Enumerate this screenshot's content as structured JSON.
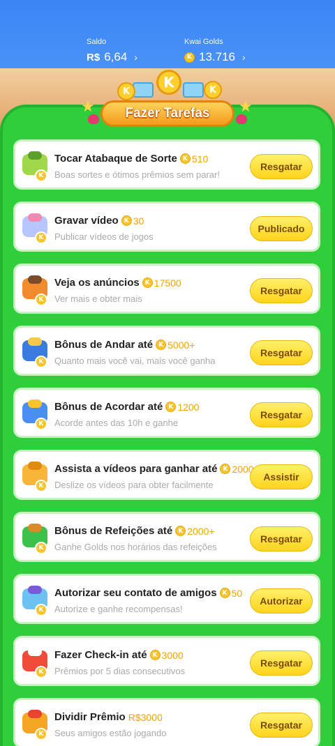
{
  "header": {
    "saldo_label": "Saldo",
    "saldo_currency": "R$",
    "saldo_value": "6,64",
    "golds_label": "Kwai Golds",
    "golds_value": "13.716",
    "chevron": "›"
  },
  "banner": {
    "title": "Fazer Tarefas",
    "coin_letter": "K"
  },
  "tasks": [
    {
      "title": "Tocar Atabaque de Sorte",
      "reward": "510",
      "subtitle": "Boas sortes e ótimos prêmios sem parar!",
      "button": "Resgatar",
      "icon": "drum-icon"
    },
    {
      "title": "Gravar vídeo",
      "reward": "30",
      "subtitle": "Publicar vídeos de jogos",
      "button": "Publicado",
      "icon": "video-camera-icon"
    },
    {
      "title": "Veja os anúncios",
      "reward": "17500",
      "subtitle": "Ver mais e obter mais",
      "button": "Resgatar",
      "icon": "tv-icon"
    },
    {
      "title": "Bônus de Andar até",
      "reward": "5000+",
      "subtitle": "Quanto mais você vai, mais você ganha",
      "button": "Resgatar",
      "icon": "walking-boy-icon"
    },
    {
      "title": "Bônus de Acordar até",
      "reward": "1200",
      "subtitle": "Acorde antes das 10h e ganhe",
      "button": "Resgatar",
      "icon": "moon-icon"
    },
    {
      "title": "Assista a vídeos para ganhar até",
      "reward": "2000",
      "subtitle": "Deslize os vídeos para obter facilmente",
      "button": "Assistir",
      "icon": "camera-icon"
    },
    {
      "title": "Bônus de Refeições até",
      "reward": "2000+",
      "subtitle": "Ganhe Golds nos horários das refeições",
      "button": "Resgatar",
      "icon": "meal-calendar-icon"
    },
    {
      "title": "Autorizar seu contato de amigos",
      "reward": "50",
      "subtitle": "Autorize e ganhe recompensas!",
      "button": "Autorizar",
      "icon": "hand-point-icon"
    },
    {
      "title": "Fazer Check-in até",
      "reward": "3000",
      "subtitle": "Prêmios por 5 dias consecutivos",
      "button": "Resgatar",
      "icon": "calendar-icon"
    },
    {
      "title": "Dividir Prêmio",
      "reward": "R$3000",
      "subtitle": "Seus amigos estão jogando",
      "button": "Resgatar",
      "icon": "gift-box-icon"
    }
  ],
  "colors": {
    "board": "#2fcf3b",
    "topbar": "#3a86f5",
    "button": "#ffd41c",
    "reward": "#f0a400"
  }
}
